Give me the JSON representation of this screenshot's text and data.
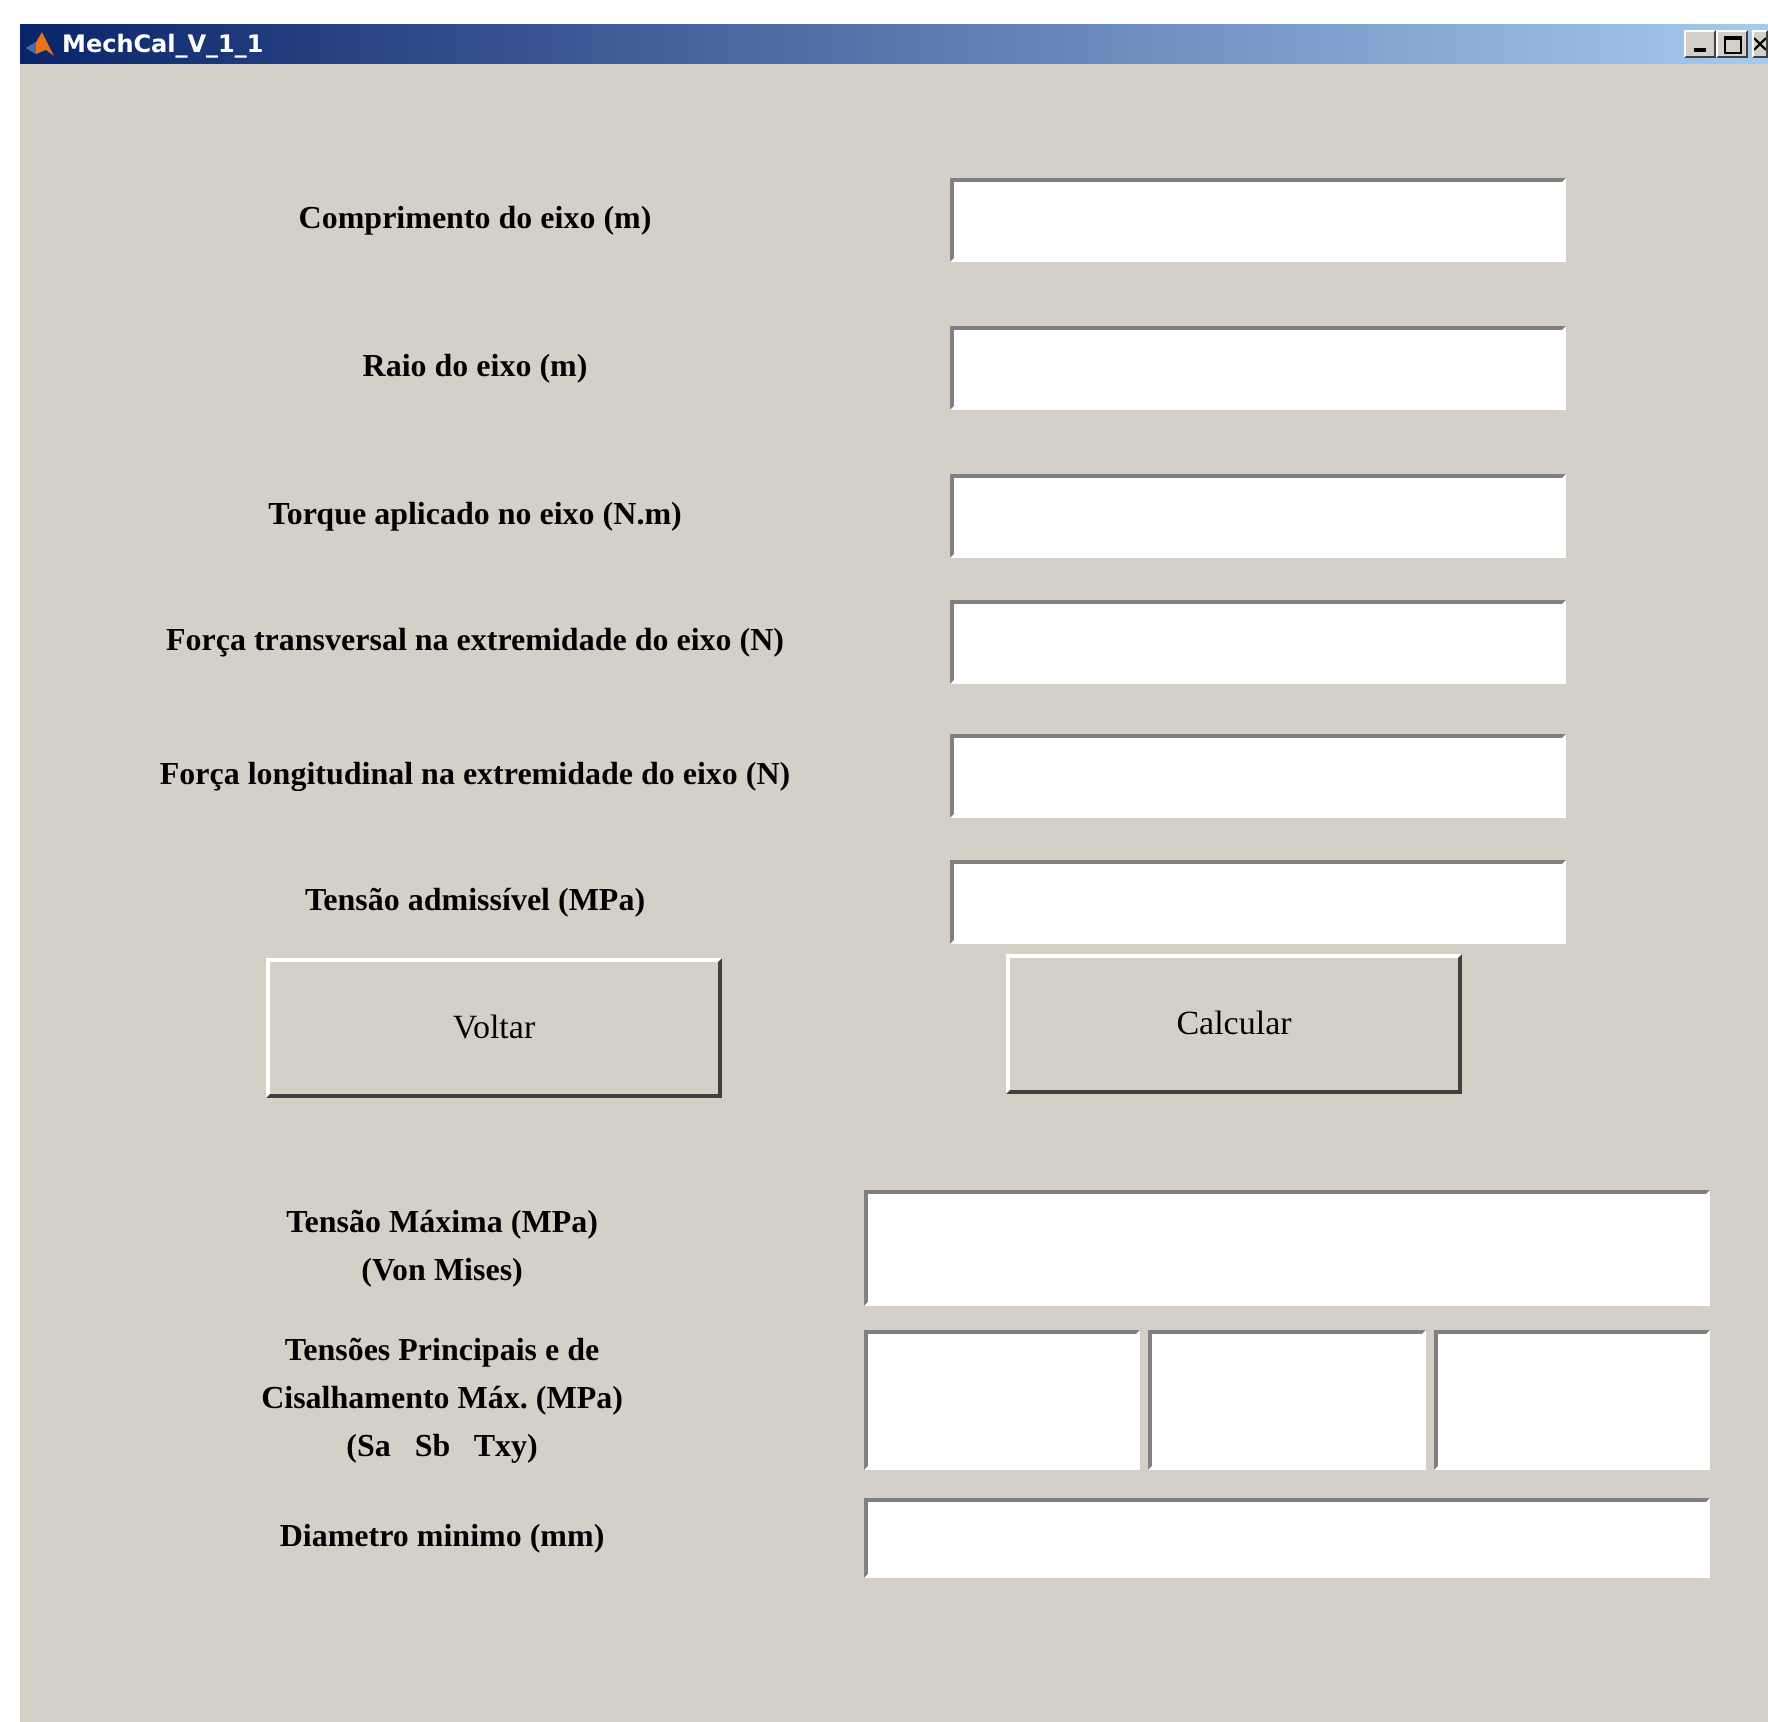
{
  "window": {
    "title": "MechCal_V_1_1"
  },
  "inputs": [
    {
      "label": "Comprimento do eixo (m)"
    },
    {
      "label": "Raio do eixo (m)"
    },
    {
      "label": "Torque aplicado no eixo (N.m)"
    },
    {
      "label": "Força transversal na extremidade do eixo (N)"
    },
    {
      "label": "Força longitudinal na extremidade do eixo (N)"
    },
    {
      "label": "Tensão admissível (MPa)"
    }
  ],
  "buttons": [
    "Voltar",
    "Calcular"
  ],
  "results": [
    {
      "label_lines": [
        "Tensão Máxima (MPa)",
        "(Von Mises)"
      ],
      "kind": "single"
    },
    {
      "label_lines": [
        "Tensões Principais e de",
        "Cisalhamento Máx. (MPa)",
        "(Sa   Sb   Txy)"
      ],
      "kind": "triple"
    },
    {
      "label_lines": [
        "Diametro minimo (mm)"
      ],
      "kind": "single"
    }
  ]
}
